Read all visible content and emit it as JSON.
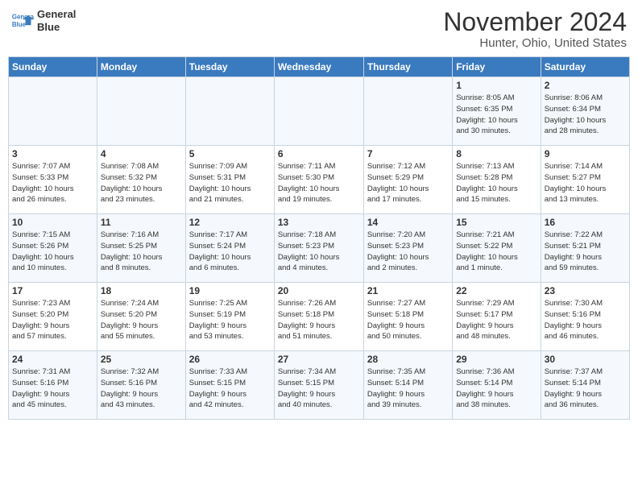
{
  "header": {
    "logo_line1": "General",
    "logo_line2": "Blue",
    "month": "November 2024",
    "location": "Hunter, Ohio, United States"
  },
  "weekdays": [
    "Sunday",
    "Monday",
    "Tuesday",
    "Wednesday",
    "Thursday",
    "Friday",
    "Saturday"
  ],
  "weeks": [
    [
      {
        "day": "",
        "info": ""
      },
      {
        "day": "",
        "info": ""
      },
      {
        "day": "",
        "info": ""
      },
      {
        "day": "",
        "info": ""
      },
      {
        "day": "",
        "info": ""
      },
      {
        "day": "1",
        "info": "Sunrise: 8:05 AM\nSunset: 6:35 PM\nDaylight: 10 hours\nand 30 minutes."
      },
      {
        "day": "2",
        "info": "Sunrise: 8:06 AM\nSunset: 6:34 PM\nDaylight: 10 hours\nand 28 minutes."
      }
    ],
    [
      {
        "day": "3",
        "info": "Sunrise: 7:07 AM\nSunset: 5:33 PM\nDaylight: 10 hours\nand 26 minutes."
      },
      {
        "day": "4",
        "info": "Sunrise: 7:08 AM\nSunset: 5:32 PM\nDaylight: 10 hours\nand 23 minutes."
      },
      {
        "day": "5",
        "info": "Sunrise: 7:09 AM\nSunset: 5:31 PM\nDaylight: 10 hours\nand 21 minutes."
      },
      {
        "day": "6",
        "info": "Sunrise: 7:11 AM\nSunset: 5:30 PM\nDaylight: 10 hours\nand 19 minutes."
      },
      {
        "day": "7",
        "info": "Sunrise: 7:12 AM\nSunset: 5:29 PM\nDaylight: 10 hours\nand 17 minutes."
      },
      {
        "day": "8",
        "info": "Sunrise: 7:13 AM\nSunset: 5:28 PM\nDaylight: 10 hours\nand 15 minutes."
      },
      {
        "day": "9",
        "info": "Sunrise: 7:14 AM\nSunset: 5:27 PM\nDaylight: 10 hours\nand 13 minutes."
      }
    ],
    [
      {
        "day": "10",
        "info": "Sunrise: 7:15 AM\nSunset: 5:26 PM\nDaylight: 10 hours\nand 10 minutes."
      },
      {
        "day": "11",
        "info": "Sunrise: 7:16 AM\nSunset: 5:25 PM\nDaylight: 10 hours\nand 8 minutes."
      },
      {
        "day": "12",
        "info": "Sunrise: 7:17 AM\nSunset: 5:24 PM\nDaylight: 10 hours\nand 6 minutes."
      },
      {
        "day": "13",
        "info": "Sunrise: 7:18 AM\nSunset: 5:23 PM\nDaylight: 10 hours\nand 4 minutes."
      },
      {
        "day": "14",
        "info": "Sunrise: 7:20 AM\nSunset: 5:23 PM\nDaylight: 10 hours\nand 2 minutes."
      },
      {
        "day": "15",
        "info": "Sunrise: 7:21 AM\nSunset: 5:22 PM\nDaylight: 10 hours\nand 1 minute."
      },
      {
        "day": "16",
        "info": "Sunrise: 7:22 AM\nSunset: 5:21 PM\nDaylight: 9 hours\nand 59 minutes."
      }
    ],
    [
      {
        "day": "17",
        "info": "Sunrise: 7:23 AM\nSunset: 5:20 PM\nDaylight: 9 hours\nand 57 minutes."
      },
      {
        "day": "18",
        "info": "Sunrise: 7:24 AM\nSunset: 5:20 PM\nDaylight: 9 hours\nand 55 minutes."
      },
      {
        "day": "19",
        "info": "Sunrise: 7:25 AM\nSunset: 5:19 PM\nDaylight: 9 hours\nand 53 minutes."
      },
      {
        "day": "20",
        "info": "Sunrise: 7:26 AM\nSunset: 5:18 PM\nDaylight: 9 hours\nand 51 minutes."
      },
      {
        "day": "21",
        "info": "Sunrise: 7:27 AM\nSunset: 5:18 PM\nDaylight: 9 hours\nand 50 minutes."
      },
      {
        "day": "22",
        "info": "Sunrise: 7:29 AM\nSunset: 5:17 PM\nDaylight: 9 hours\nand 48 minutes."
      },
      {
        "day": "23",
        "info": "Sunrise: 7:30 AM\nSunset: 5:16 PM\nDaylight: 9 hours\nand 46 minutes."
      }
    ],
    [
      {
        "day": "24",
        "info": "Sunrise: 7:31 AM\nSunset: 5:16 PM\nDaylight: 9 hours\nand 45 minutes."
      },
      {
        "day": "25",
        "info": "Sunrise: 7:32 AM\nSunset: 5:16 PM\nDaylight: 9 hours\nand 43 minutes."
      },
      {
        "day": "26",
        "info": "Sunrise: 7:33 AM\nSunset: 5:15 PM\nDaylight: 9 hours\nand 42 minutes."
      },
      {
        "day": "27",
        "info": "Sunrise: 7:34 AM\nSunset: 5:15 PM\nDaylight: 9 hours\nand 40 minutes."
      },
      {
        "day": "28",
        "info": "Sunrise: 7:35 AM\nSunset: 5:14 PM\nDaylight: 9 hours\nand 39 minutes."
      },
      {
        "day": "29",
        "info": "Sunrise: 7:36 AM\nSunset: 5:14 PM\nDaylight: 9 hours\nand 38 minutes."
      },
      {
        "day": "30",
        "info": "Sunrise: 7:37 AM\nSunset: 5:14 PM\nDaylight: 9 hours\nand 36 minutes."
      }
    ]
  ]
}
